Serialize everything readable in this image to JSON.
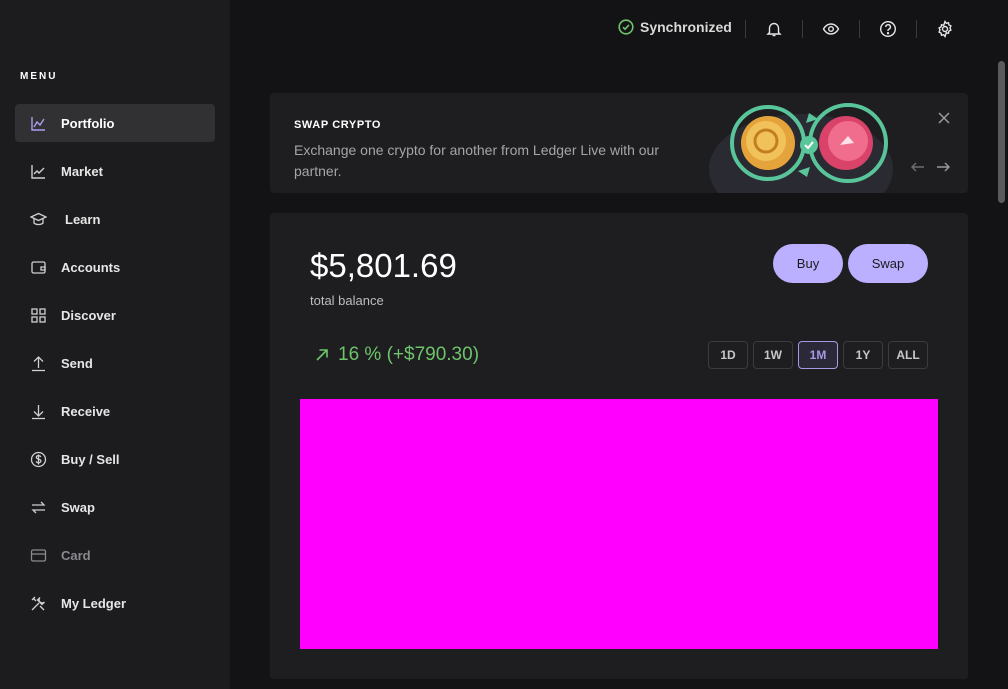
{
  "sidebar": {
    "menu_heading": "MENU",
    "items": [
      {
        "label": "Portfolio",
        "icon": "chart-line-icon",
        "active": true
      },
      {
        "label": "Market",
        "icon": "market-chart-icon"
      },
      {
        "label": "Learn",
        "icon": "graduation-cap-icon"
      },
      {
        "label": "Accounts",
        "icon": "wallet-icon"
      },
      {
        "label": "Discover",
        "icon": "grid-icon"
      },
      {
        "label": "Send",
        "icon": "arrow-up-icon"
      },
      {
        "label": "Receive",
        "icon": "arrow-down-icon"
      },
      {
        "label": "Buy / Sell",
        "icon": "dollar-circle-icon"
      },
      {
        "label": "Swap",
        "icon": "swap-icon"
      },
      {
        "label": "Card",
        "icon": "card-icon",
        "disabled": true
      },
      {
        "label": "My Ledger",
        "icon": "tools-icon"
      }
    ]
  },
  "topbar": {
    "sync_status": "Synchronized",
    "icons": [
      "bell-icon",
      "eye-icon",
      "help-icon",
      "settings-icon"
    ]
  },
  "banner": {
    "title": "SWAP CRYPTO",
    "description": "Exchange one crypto for another from Ledger Live with our partner."
  },
  "portfolio": {
    "balance": "$5,801.69",
    "balance_label": "total balance",
    "buy_label": "Buy",
    "swap_label": "Swap",
    "change": "16 % (+$790.30)",
    "ranges": [
      "1D",
      "1W",
      "1M",
      "1Y",
      "ALL"
    ],
    "selected_range": "1M"
  },
  "colors": {
    "accent": "#bbb0ff",
    "positive": "#6ec46a",
    "chart_placeholder": "#ff00ff"
  }
}
